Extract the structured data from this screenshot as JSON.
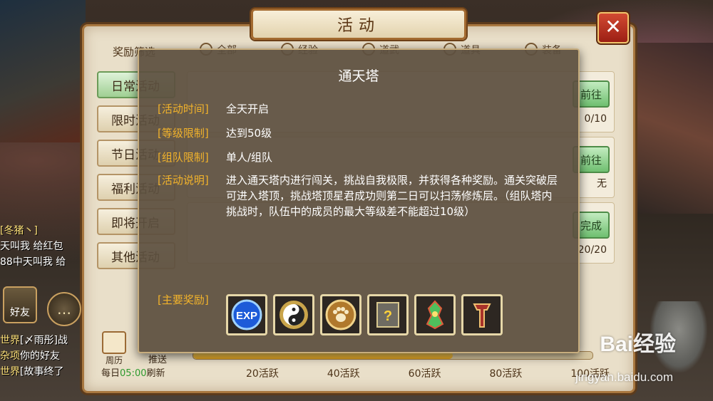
{
  "panel": {
    "title": "活动",
    "close_label": "✕",
    "filter_label": "奖励筛选",
    "filter_options": [
      "全部",
      "经验",
      "道武",
      "道具",
      "装备"
    ],
    "side_tabs": [
      "日常活动",
      "限时活动",
      "节日活动",
      "福利活动",
      "即将开启",
      "其他活动"
    ],
    "rows": [
      {
        "go": "前往",
        "count": "0/10"
      },
      {
        "go": "前往",
        "count": "无"
      },
      {
        "go": "完成",
        "count": "20/20"
      },
      {
        "go": "完成",
        "count": ""
      }
    ],
    "progress_value": "65",
    "progress_fraction": 0.65,
    "progress_marks": [
      "20活跃",
      "40活跃",
      "60活跃",
      "80活跃",
      "100活跃"
    ],
    "daily_prefix": "每日",
    "daily_time": "05:00",
    "daily_suffix": "刷新",
    "calendar_label": "周历",
    "push_label": "推送"
  },
  "chat": {
    "lines": [
      {
        "tag": "[冬猪丶]",
        "text": ""
      },
      {
        "tag": "",
        "text": "天叫我 给红包"
      },
      {
        "tag": "",
        "text": "88中天叫我 给"
      }
    ],
    "friend_label": "好友",
    "lower_lines": [
      {
        "tag": "世界",
        "text": "[〆雨彤]战"
      },
      {
        "tag": "杂项",
        "text": "你的好友"
      },
      {
        "tag": "世界",
        "text": "[故事终了"
      }
    ]
  },
  "modal": {
    "title": "通天塔",
    "time_label": "[活动时间]",
    "time_value": "全天开启",
    "level_label": "[等级限制]",
    "level_value": "达到50级",
    "team_label": "[组队限制]",
    "team_value": "单人/组队",
    "desc_label": "[活动说明]",
    "desc_value": "进入通天塔内进行闯关，挑战自我极限，并获得各种奖励。通关突破层可进入塔顶，挑战塔顶星君成功则第二日可以扫荡修炼层。（组队塔内挑战时，队伍中的成员的最大等级差不能超过10级）",
    "reward_label": "[主要奖励]",
    "rewards": [
      {
        "icon": "exp-icon",
        "text": "EXP"
      },
      {
        "icon": "taiji-icon",
        "text": ""
      },
      {
        "icon": "paw-icon",
        "text": ""
      },
      {
        "icon": "mystery-scroll-icon",
        "text": "?"
      },
      {
        "icon": "jade-charm-icon",
        "text": ""
      },
      {
        "icon": "red-weapon-icon",
        "text": ""
      }
    ]
  },
  "watermark": {
    "brand": "Bai经验",
    "url": "jingyan.baidu.com"
  }
}
